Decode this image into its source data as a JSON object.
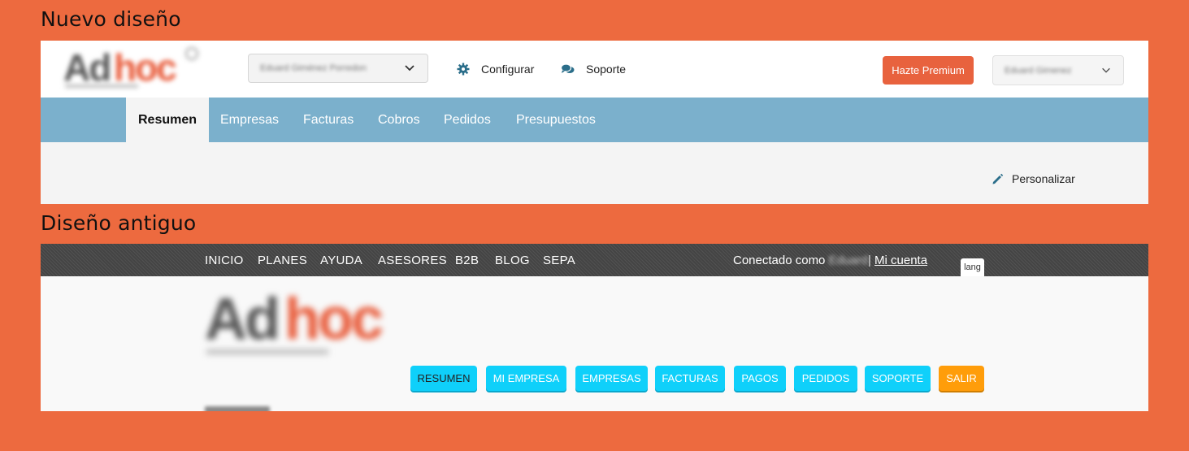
{
  "labels": {
    "new_design": "Nuevo diseño",
    "old_design": "Diseño antiguo"
  },
  "new_design": {
    "company_select_value": "Eduard Giménez Porredon",
    "configure_label": "Configurar",
    "support_label": "Soporte",
    "premium_button": "Hazte Premium",
    "user_select_value": "Eduard Gimenez",
    "tabs": [
      {
        "label": "Resumen",
        "active": true
      },
      {
        "label": "Empresas"
      },
      {
        "label": "Facturas"
      },
      {
        "label": "Cobros"
      },
      {
        "label": "Pedidos"
      },
      {
        "label": "Presupuestos"
      }
    ],
    "customize_label": "Personalizar"
  },
  "old_design": {
    "top_nav": [
      "INICIO",
      "PLANES",
      "AYUDA",
      "ASESORES",
      "B2B",
      "BLOG",
      "SEPA"
    ],
    "connected_as": "Conectado como",
    "user_name": "Eduard",
    "separator": "|",
    "my_account": "Mi cuenta",
    "lang": "lang",
    "buttons": [
      {
        "label": "RESUMEN",
        "active": true
      },
      {
        "label": "MI EMPRESA"
      },
      {
        "label": "EMPRESAS"
      },
      {
        "label": "FACTURAS"
      },
      {
        "label": "PAGOS"
      },
      {
        "label": "PEDIDOS"
      },
      {
        "label": "SOPORTE"
      },
      {
        "label": "SALIR",
        "variant": "exit"
      }
    ]
  },
  "colors": {
    "background": "#ed6a3f",
    "new_nav": "#7bb0cc",
    "premium": "#e8623e",
    "old_button": "#0fd0fa",
    "old_exit_button": "#ff9d0a",
    "icon_teal": "#2b6e8a"
  },
  "icons": {
    "configure": "gear-icon",
    "support": "chat-bubbles-icon",
    "customize": "pencil-icon",
    "dropdown": "chevron-down-icon"
  }
}
